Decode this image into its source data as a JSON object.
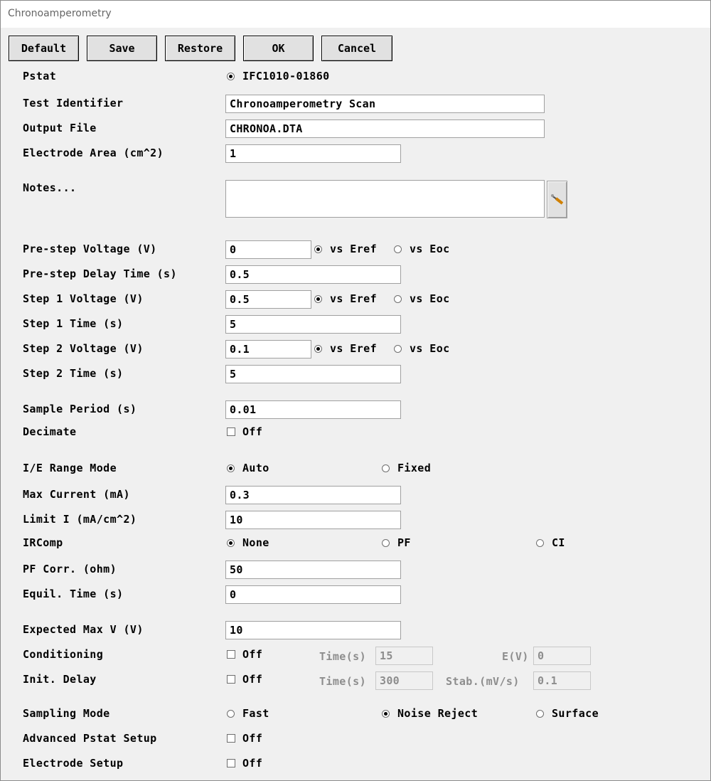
{
  "window": {
    "title": "Chronoamperometry"
  },
  "buttons": {
    "default": "Default",
    "save": "Save",
    "restore": "Restore",
    "ok": "OK",
    "cancel": "Cancel"
  },
  "labels": {
    "pstat": "Pstat",
    "test_identifier": "Test Identifier",
    "output_file": "Output File",
    "electrode_area": "Electrode Area (cm^2)",
    "notes": "Notes...",
    "prestep_voltage": "Pre-step Voltage (V)",
    "prestep_delay": "Pre-step Delay Time (s)",
    "step1_voltage": "Step 1 Voltage (V)",
    "step1_time": "Step 1 Time (s)",
    "step2_voltage": "Step 2 Voltage (V)",
    "step2_time": "Step 2 Time (s)",
    "sample_period": "Sample Period (s)",
    "decimate": "Decimate",
    "ie_range_mode": "I/E Range Mode",
    "max_current": "Max Current (mA)",
    "limit_i": "Limit I (mA/cm^2)",
    "ircomp": "IRComp",
    "pf_corr": "PF Corr. (ohm)",
    "equil_time": "Equil. Time (s)",
    "expected_max_v": "Expected Max V (V)",
    "conditioning": "Conditioning",
    "init_delay": "Init. Delay",
    "sampling_mode": "Sampling Mode",
    "advanced_pstat": "Advanced Pstat Setup",
    "electrode_setup": "Electrode Setup"
  },
  "values": {
    "pstat": "IFC1010-01860",
    "test_identifier": "Chronoamperometry Scan",
    "output_file": "CHRONOA.DTA",
    "electrode_area": "1",
    "notes": "",
    "prestep_voltage": "0",
    "prestep_delay": "0.5",
    "step1_voltage": "0.5",
    "step1_time": "5",
    "step2_voltage": "0.1",
    "step2_time": "5",
    "sample_period": "0.01",
    "max_current": "0.3",
    "limit_i": "10",
    "pf_corr": "50",
    "equil_time": "0",
    "expected_max_v": "10",
    "cond_time": "15",
    "cond_e": "0",
    "init_time": "300",
    "init_stab": "0.1"
  },
  "options": {
    "vs_eref": "vs Eref",
    "vs_eoc": "vs Eoc",
    "off": "Off",
    "auto": "Auto",
    "fixed": "Fixed",
    "none": "None",
    "pf": "PF",
    "ci": "CI",
    "time_s": "Time(s)",
    "e_v": "E(V)",
    "stab": "Stab.(mV/s)",
    "fast": "Fast",
    "noise_reject": "Noise Reject",
    "surface": "Surface"
  },
  "icons": {
    "notes_button": "pen-icon"
  }
}
